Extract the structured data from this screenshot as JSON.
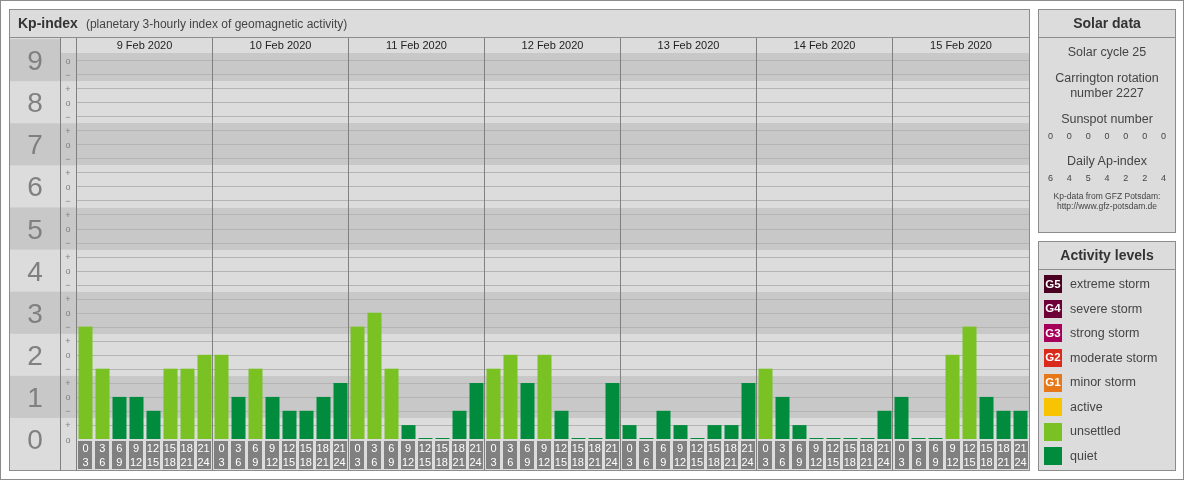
{
  "header": {
    "title": "Kp-index",
    "subtitle": "(planetary 3-hourly index of geomagnetic activity)"
  },
  "chart": {
    "days": [
      "9 Feb 2020",
      "10 Feb 2020",
      "11 Feb 2020",
      "12 Feb 2020",
      "13 Feb 2020",
      "14 Feb 2020",
      "15 Feb 2020"
    ],
    "kp_marks": [
      "o",
      "−",
      "+",
      "o",
      "−",
      "+",
      "o",
      "−",
      "+",
      "o",
      "−",
      "+",
      "o",
      "−",
      "+",
      "o",
      "−",
      "+",
      "o",
      "−",
      "+",
      "o",
      "−",
      "+",
      "o",
      "−",
      "+",
      "o"
    ],
    "chart_data": {
      "type": "bar",
      "stacked": true,
      "grid": true,
      "ylim": [
        0,
        9
      ],
      "yticks": [
        0,
        1,
        2,
        3,
        4,
        5,
        6,
        7,
        8,
        9
      ],
      "categories": [
        "0 3",
        "3 6",
        "6 9",
        "9 12",
        "12 15",
        "15 18",
        "18 21",
        "21 24",
        "0 3",
        "3 6",
        "6 9",
        "9 12",
        "12 15",
        "15 18",
        "18 21",
        "21 24",
        "0 3",
        "3 6",
        "6 9",
        "9 12",
        "12 15",
        "15 18",
        "18 21",
        "21 24",
        "0 3",
        "3 6",
        "6 9",
        "9 12",
        "12 15",
        "15 18",
        "18 21",
        "21 24",
        "0 3",
        "3 6",
        "6 9",
        "9 12",
        "12 15",
        "15 18",
        "18 21",
        "21 24",
        "0 3",
        "3 6",
        "6 9",
        "9 12",
        "12 15",
        "15 18",
        "18 21",
        "21 24",
        "0 3",
        "3 6",
        "6 9",
        "9 12",
        "12 15",
        "15 18",
        "18 21",
        "21 24"
      ],
      "series": [
        {
          "color": "#008c3c",
          "values": [
            null,
            null,
            1,
            1,
            0.67,
            null,
            null,
            null,
            null,
            1,
            null,
            1,
            0.67,
            0.67,
            1,
            1.33,
            null,
            null,
            null,
            0.33,
            0,
            0,
            0.67,
            1.33,
            null,
            null,
            1.33,
            null,
            0.67,
            0,
            0,
            1.33,
            0.33,
            0,
            0.67,
            0.33,
            0,
            0.33,
            0.33,
            1.33,
            null,
            1,
            0.33,
            0,
            0,
            0,
            0,
            0.67,
            1,
            0,
            0,
            null,
            null,
            1,
            0.67,
            0.67
          ]
        },
        {
          "color": "#7ac124",
          "values": [
            2.67,
            1.67,
            null,
            null,
            null,
            1.67,
            1.67,
            2,
            2,
            null,
            1.67,
            null,
            null,
            null,
            null,
            null,
            2.67,
            3,
            1.67,
            null,
            null,
            null,
            null,
            null,
            1.67,
            2,
            null,
            2,
            null,
            null,
            null,
            null,
            null,
            null,
            null,
            null,
            null,
            null,
            null,
            null,
            1.67,
            null,
            null,
            null,
            null,
            null,
            null,
            null,
            null,
            null,
            null,
            2,
            2.67,
            null,
            null,
            null
          ]
        }
      ]
    }
  },
  "solar_data": {
    "title": "Solar data",
    "solar_cycle": "Solar cycle 25",
    "carrington": "Carrington rotation number 2227",
    "sunspot_title": "Sunspot number",
    "sunspot_values": [
      "0",
      "0",
      "0",
      "0",
      "0",
      "0",
      "0"
    ],
    "ap_title": "Daily Ap-index",
    "ap_values": [
      "6",
      "4",
      "5",
      "4",
      "2",
      "2",
      "4"
    ],
    "source_lines": [
      "Kp-data from GFZ Potsdam:",
      "http://www.gfz-potsdam.de"
    ]
  },
  "activity_levels": {
    "title": "Activity levels",
    "items": [
      {
        "badge": "G5",
        "label": "extreme storm",
        "color": "#4a0020"
      },
      {
        "badge": "G4",
        "label": "severe storm",
        "color": "#6e0038"
      },
      {
        "badge": "G3",
        "label": "strong storm",
        "color": "#a5005a"
      },
      {
        "badge": "G2",
        "label": "moderate storm",
        "color": "#d92a1c"
      },
      {
        "badge": "G1",
        "label": "minor storm",
        "color": "#e6781a"
      },
      {
        "label": "active",
        "color": "#f8c300"
      },
      {
        "label": "unsettled",
        "color": "#7ac124"
      },
      {
        "label": "quiet",
        "color": "#008c3c"
      }
    ]
  }
}
